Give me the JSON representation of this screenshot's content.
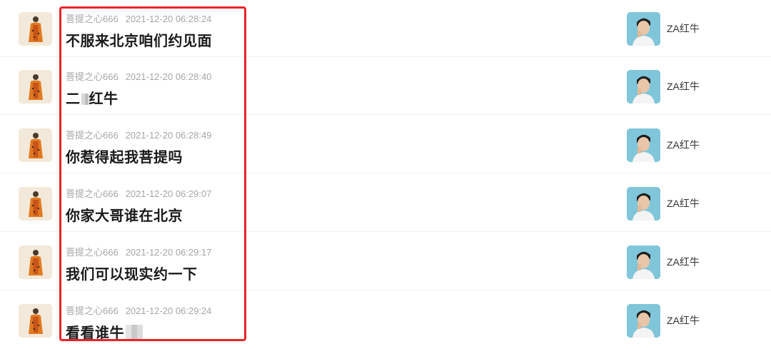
{
  "highlight_color": "#e8232a",
  "sender": {
    "name": "菩提之心666",
    "avatar_icon": "monk-figure-avatar"
  },
  "receiver": {
    "name": "ZA红牛",
    "avatar_icon": "person-photo-avatar"
  },
  "messages": [
    {
      "timestamp": "2021-12-20 06:28:24",
      "text": "不服来北京咱们约见面"
    },
    {
      "timestamp": "2021-12-20 06:28:40",
      "text_before": "二",
      "text_after": "红牛"
    },
    {
      "timestamp": "2021-12-20 06:28:49",
      "text": "你惹得起我菩提吗"
    },
    {
      "timestamp": "2021-12-20 06:29:07",
      "text": "你家大哥谁在北京"
    },
    {
      "timestamp": "2021-12-20 06:29:17",
      "text": "我们可以现实约一下"
    },
    {
      "timestamp": "2021-12-20 06:29:24",
      "text_before": "看看谁牛",
      "text_after": ""
    }
  ]
}
